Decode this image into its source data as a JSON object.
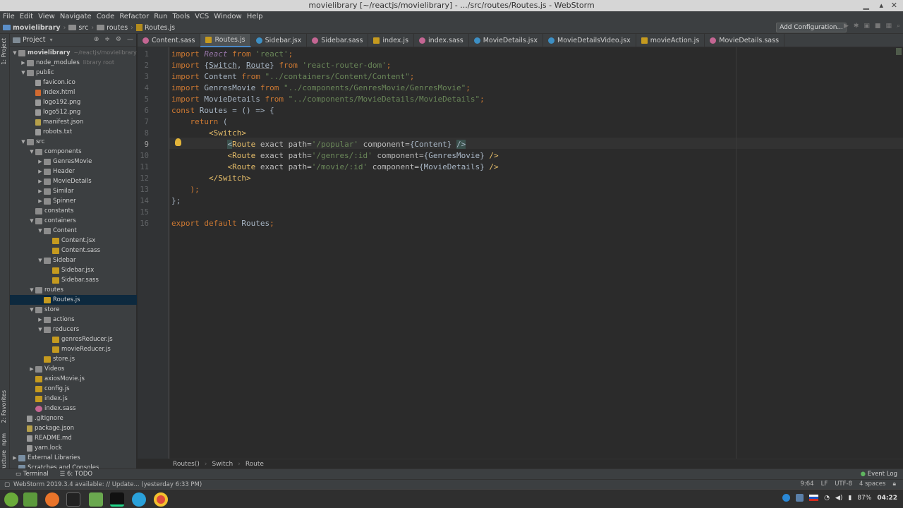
{
  "window": {
    "title": "movielibrary [~/reactjs/movielibrary] - .../src/routes/Routes.js - WebStorm"
  },
  "menu": [
    "File",
    "Edit",
    "View",
    "Navigate",
    "Code",
    "Refactor",
    "Run",
    "Tools",
    "VCS",
    "Window",
    "Help"
  ],
  "breadcrumb": [
    "movielibrary",
    "src",
    "routes",
    "Routes.js"
  ],
  "toolbar": {
    "add_config": "Add Configuration..."
  },
  "left_strip": {
    "project": "1: Project",
    "favorites": "2: Favorites",
    "npm": "npm",
    "structure": "7: Structure"
  },
  "project_panel": {
    "title": "Project",
    "tree": [
      {
        "label": "movielibrary",
        "extra": "~/reactjs/movielibrary",
        "depth": 0,
        "arrow": "▼",
        "icon": "folder",
        "bold": true
      },
      {
        "label": "node_modules",
        "extra": "library root",
        "depth": 1,
        "arrow": "▶",
        "icon": "folder"
      },
      {
        "label": "public",
        "extra": "",
        "depth": 1,
        "arrow": "▼",
        "icon": "folder"
      },
      {
        "label": "favicon.ico",
        "extra": "",
        "depth": 2,
        "arrow": "",
        "icon": "file"
      },
      {
        "label": "index.html",
        "extra": "",
        "depth": 2,
        "arrow": "",
        "icon": "html"
      },
      {
        "label": "logo192.png",
        "extra": "",
        "depth": 2,
        "arrow": "",
        "icon": "file"
      },
      {
        "label": "logo512.png",
        "extra": "",
        "depth": 2,
        "arrow": "",
        "icon": "file"
      },
      {
        "label": "manifest.json",
        "extra": "",
        "depth": 2,
        "arrow": "",
        "icon": "json"
      },
      {
        "label": "robots.txt",
        "extra": "",
        "depth": 2,
        "arrow": "",
        "icon": "file"
      },
      {
        "label": "src",
        "extra": "",
        "depth": 1,
        "arrow": "▼",
        "icon": "folder"
      },
      {
        "label": "components",
        "extra": "",
        "depth": 2,
        "arrow": "▼",
        "icon": "folder"
      },
      {
        "label": "GenresMovie",
        "extra": "",
        "depth": 3,
        "arrow": "▶",
        "icon": "folder"
      },
      {
        "label": "Header",
        "extra": "",
        "depth": 3,
        "arrow": "▶",
        "icon": "folder"
      },
      {
        "label": "MovieDetails",
        "extra": "",
        "depth": 3,
        "arrow": "▶",
        "icon": "folder"
      },
      {
        "label": "Similar",
        "extra": "",
        "depth": 3,
        "arrow": "▶",
        "icon": "folder"
      },
      {
        "label": "Spinner",
        "extra": "",
        "depth": 3,
        "arrow": "▶",
        "icon": "folder"
      },
      {
        "label": "constants",
        "extra": "",
        "depth": 2,
        "arrow": "",
        "icon": "folder"
      },
      {
        "label": "containers",
        "extra": "",
        "depth": 2,
        "arrow": "▼",
        "icon": "folder"
      },
      {
        "label": "Content",
        "extra": "",
        "depth": 3,
        "arrow": "▼",
        "icon": "folder"
      },
      {
        "label": "Content.jsx",
        "extra": "",
        "depth": 4,
        "arrow": "",
        "icon": "js"
      },
      {
        "label": "Content.sass",
        "extra": "",
        "depth": 4,
        "arrow": "",
        "icon": "js"
      },
      {
        "label": "Sidebar",
        "extra": "",
        "depth": 3,
        "arrow": "▼",
        "icon": "folder"
      },
      {
        "label": "Sidebar.jsx",
        "extra": "",
        "depth": 4,
        "arrow": "",
        "icon": "js"
      },
      {
        "label": "Sidebar.sass",
        "extra": "",
        "depth": 4,
        "arrow": "",
        "icon": "js"
      },
      {
        "label": "routes",
        "extra": "",
        "depth": 2,
        "arrow": "▼",
        "icon": "folder"
      },
      {
        "label": "Routes.js",
        "extra": "",
        "depth": 3,
        "arrow": "",
        "icon": "js",
        "selected": true
      },
      {
        "label": "store",
        "extra": "",
        "depth": 2,
        "arrow": "▼",
        "icon": "folder"
      },
      {
        "label": "actions",
        "extra": "",
        "depth": 3,
        "arrow": "▶",
        "icon": "folder"
      },
      {
        "label": "reducers",
        "extra": "",
        "depth": 3,
        "arrow": "▼",
        "icon": "folder"
      },
      {
        "label": "genresReducer.js",
        "extra": "",
        "depth": 4,
        "arrow": "",
        "icon": "js"
      },
      {
        "label": "movieReducer.js",
        "extra": "",
        "depth": 4,
        "arrow": "",
        "icon": "js"
      },
      {
        "label": "store.js",
        "extra": "",
        "depth": 3,
        "arrow": "",
        "icon": "js"
      },
      {
        "label": "Videos",
        "extra": "",
        "depth": 2,
        "arrow": "▶",
        "icon": "folder"
      },
      {
        "label": "axiosMovie.js",
        "extra": "",
        "depth": 2,
        "arrow": "",
        "icon": "js"
      },
      {
        "label": "config.js",
        "extra": "",
        "depth": 2,
        "arrow": "",
        "icon": "js"
      },
      {
        "label": "index.js",
        "extra": "",
        "depth": 2,
        "arrow": "",
        "icon": "js"
      },
      {
        "label": "index.sass",
        "extra": "",
        "depth": 2,
        "arrow": "",
        "icon": "sass"
      },
      {
        "label": ".gitignore",
        "extra": "",
        "depth": 1,
        "arrow": "",
        "icon": "file"
      },
      {
        "label": "package.json",
        "extra": "",
        "depth": 1,
        "arrow": "",
        "icon": "json"
      },
      {
        "label": "README.md",
        "extra": "",
        "depth": 1,
        "arrow": "",
        "icon": "file"
      },
      {
        "label": "yarn.lock",
        "extra": "",
        "depth": 1,
        "arrow": "",
        "icon": "file"
      },
      {
        "label": "External Libraries",
        "extra": "",
        "depth": 0,
        "arrow": "▶",
        "icon": "lib"
      },
      {
        "label": "Scratches and Consoles",
        "extra": "",
        "depth": 0,
        "arrow": "",
        "icon": "lib"
      }
    ]
  },
  "tabs": [
    {
      "label": "Content.sass",
      "icon": "sass",
      "active": false
    },
    {
      "label": "Routes.js",
      "icon": "js",
      "active": true
    },
    {
      "label": "Sidebar.jsx",
      "icon": "jsx",
      "active": false
    },
    {
      "label": "Sidebar.sass",
      "icon": "sass",
      "active": false
    },
    {
      "label": "index.js",
      "icon": "js",
      "active": false
    },
    {
      "label": "index.sass",
      "icon": "sass",
      "active": false
    },
    {
      "label": "MovieDetails.jsx",
      "icon": "jsx",
      "active": false
    },
    {
      "label": "MovieDetailsVideo.jsx",
      "icon": "jsx",
      "active": false
    },
    {
      "label": "movieAction.js",
      "icon": "js",
      "active": false
    },
    {
      "label": "MovieDetails.sass",
      "icon": "sass",
      "active": false
    }
  ],
  "editor": {
    "current_line": 9,
    "lines": [
      [
        [
          "kw",
          "import "
        ],
        [
          "it",
          "React"
        ],
        [
          "kw",
          " from "
        ],
        [
          "str",
          "'react'"
        ],
        [
          "kw",
          ";"
        ]
      ],
      [
        [
          "kw",
          "import "
        ],
        [
          "cls",
          "{"
        ],
        [
          "ul",
          "Switch"
        ],
        [
          "cls",
          ", "
        ],
        [
          "ul",
          "Route"
        ],
        [
          "cls",
          "} "
        ],
        [
          "kw",
          "from "
        ],
        [
          "str",
          "'react-router-dom'"
        ],
        [
          "kw",
          ";"
        ]
      ],
      [
        [
          "kw",
          "import "
        ],
        [
          "cls",
          "Content "
        ],
        [
          "kw",
          "from "
        ],
        [
          "str",
          "\"../containers/Content/Content\""
        ],
        [
          "kw",
          ";"
        ]
      ],
      [
        [
          "kw",
          "import "
        ],
        [
          "cls",
          "GenresMovie "
        ],
        [
          "kw",
          "from "
        ],
        [
          "str",
          "\"../components/GenresMovie/GenresMovie\""
        ],
        [
          "kw",
          ";"
        ]
      ],
      [
        [
          "kw",
          "import "
        ],
        [
          "cls",
          "MovieDetails "
        ],
        [
          "kw",
          "from "
        ],
        [
          "str",
          "\"../components/MovieDetails/MovieDetails\""
        ],
        [
          "kw",
          ";"
        ]
      ],
      [
        [
          "kw",
          "const "
        ],
        [
          "cls",
          "Routes = () => {"
        ]
      ],
      [
        [
          "cls",
          "    "
        ],
        [
          "kw",
          "return "
        ],
        [
          "cls",
          "("
        ]
      ],
      [
        [
          "cls",
          "        "
        ],
        [
          "tag",
          "<Switch>"
        ]
      ],
      [
        [
          "cls",
          "            "
        ],
        [
          "hl",
          "<"
        ],
        [
          "tag",
          "Route "
        ],
        [
          "attr",
          "exact path="
        ],
        [
          "str",
          "'/popular'"
        ],
        [
          "attr",
          " component="
        ],
        [
          "cls",
          "{Content} "
        ],
        [
          "hl",
          "/>"
        ]
      ],
      [
        [
          "cls",
          "            "
        ],
        [
          "tag",
          "<Route "
        ],
        [
          "attr",
          "exact path="
        ],
        [
          "str",
          "'/genres/:id'"
        ],
        [
          "attr",
          " component="
        ],
        [
          "cls",
          "{GenresMovie} "
        ],
        [
          "tag",
          "/>"
        ]
      ],
      [
        [
          "cls",
          "            "
        ],
        [
          "tag",
          "<Route "
        ],
        [
          "attr",
          "exact path="
        ],
        [
          "str",
          "'/movie/:id'"
        ],
        [
          "attr",
          " component="
        ],
        [
          "cls",
          "{MovieDetails} "
        ],
        [
          "tag",
          "/>"
        ]
      ],
      [
        [
          "cls",
          "        "
        ],
        [
          "tag",
          "</Switch>"
        ]
      ],
      [
        [
          "cls",
          "    "
        ],
        [
          "kw",
          ");"
        ]
      ],
      [
        [
          "cls",
          "};"
        ]
      ],
      [],
      [
        [
          "kw",
          "export default "
        ],
        [
          "cls",
          "Routes"
        ],
        [
          "kw",
          ";"
        ]
      ]
    ]
  },
  "code_crumbs": [
    "Routes()",
    "Switch",
    "Route"
  ],
  "bottom_tools": {
    "terminal": "Terminal",
    "todo": "6: TODO",
    "event_log": "Event Log"
  },
  "status": {
    "message": "WebStorm 2019.3.4 available: // Update... (yesterday 6:33 PM)",
    "position": "9:64",
    "line_sep": "LF",
    "encoding": "UTF-8",
    "indent": "4 spaces"
  },
  "taskbar": {
    "battery": "87%",
    "time": "04:22"
  }
}
